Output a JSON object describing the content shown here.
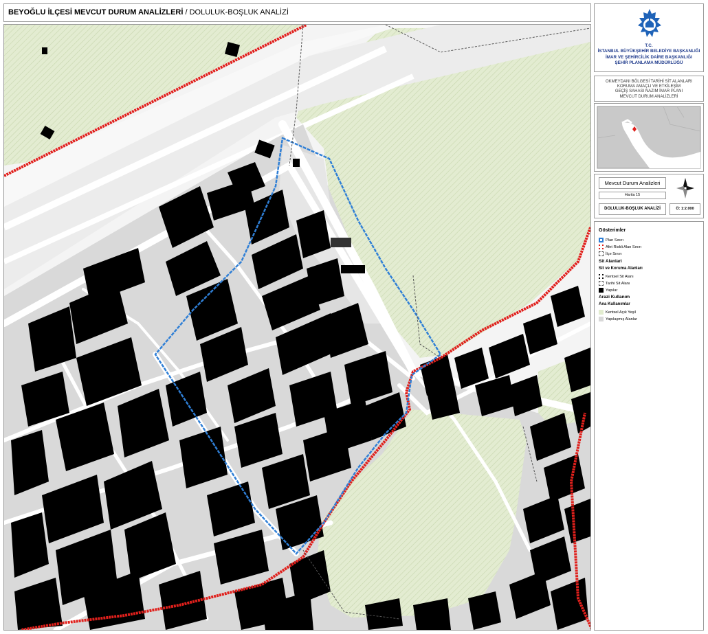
{
  "header": {
    "title_bold": "BEYOĞLU İLÇESİ MEVCUT DURUM ANALİZLERİ",
    "title_rest": " / DOLULUK-BOŞLUK ANALİZİ"
  },
  "institution": {
    "line1": "T.C.",
    "line2": "İSTANBUL BÜYÜKŞEHİR BELEDİYE BAŞKANLIĞI",
    "line3": "İMAR VE ŞEHİRCİLİK DAİRE BAŞKANLIĞI",
    "line4": "ŞEHİR PLANLAMA MÜDÜRLÜĞÜ"
  },
  "plan_title": {
    "line1": "OKMEYDANI BÖLGESİ TARİHİ SİT ALANLARI",
    "line2": "KORUMA AMAÇLI VE ETKİLEŞİM",
    "line3": "GEÇİŞ SAHASI NAZIM İMAR PLANI",
    "line4": "MEVCUT DURUM ANALİZLERİ"
  },
  "analysis": {
    "section": "Mevcut Durum Analizleri",
    "sheet": "Harita 15",
    "name": "DOLULUK-BOŞLUK ANALİZİ",
    "scale": "Ö: 1:2.000"
  },
  "legend": {
    "title": "Gösterimler",
    "items_top": [
      "Plan Sınırı",
      "Afet Riskli Alan Sınırı",
      "İlçe Sınırı"
    ],
    "sit_title": "Sit Alanlari",
    "sit_sub": "Sit ve Koruma Alanları",
    "sit_items": [
      "Kentsel Sit Alanı",
      "Tarihi Sit Alanı"
    ],
    "buildings": "Yapılar",
    "land_title": "Arazi Kullanım",
    "land_sub": "Ana Kullanımlar",
    "land_items": [
      "Kentsel Açık Yeşil",
      "Yapılaşmış Alanlar"
    ]
  },
  "colors": {
    "plan_boundary": "#2f7fd6",
    "risk_boundary": "#e0201c",
    "green_area": "#e2eccf",
    "built_area": "#d8d8d8",
    "building": "#000000",
    "institution_text": "#1f3b8c"
  },
  "icons": {
    "logo": "ibb-logo-icon",
    "north_arrow": "north-arrow-icon",
    "locator": "locator-map"
  }
}
